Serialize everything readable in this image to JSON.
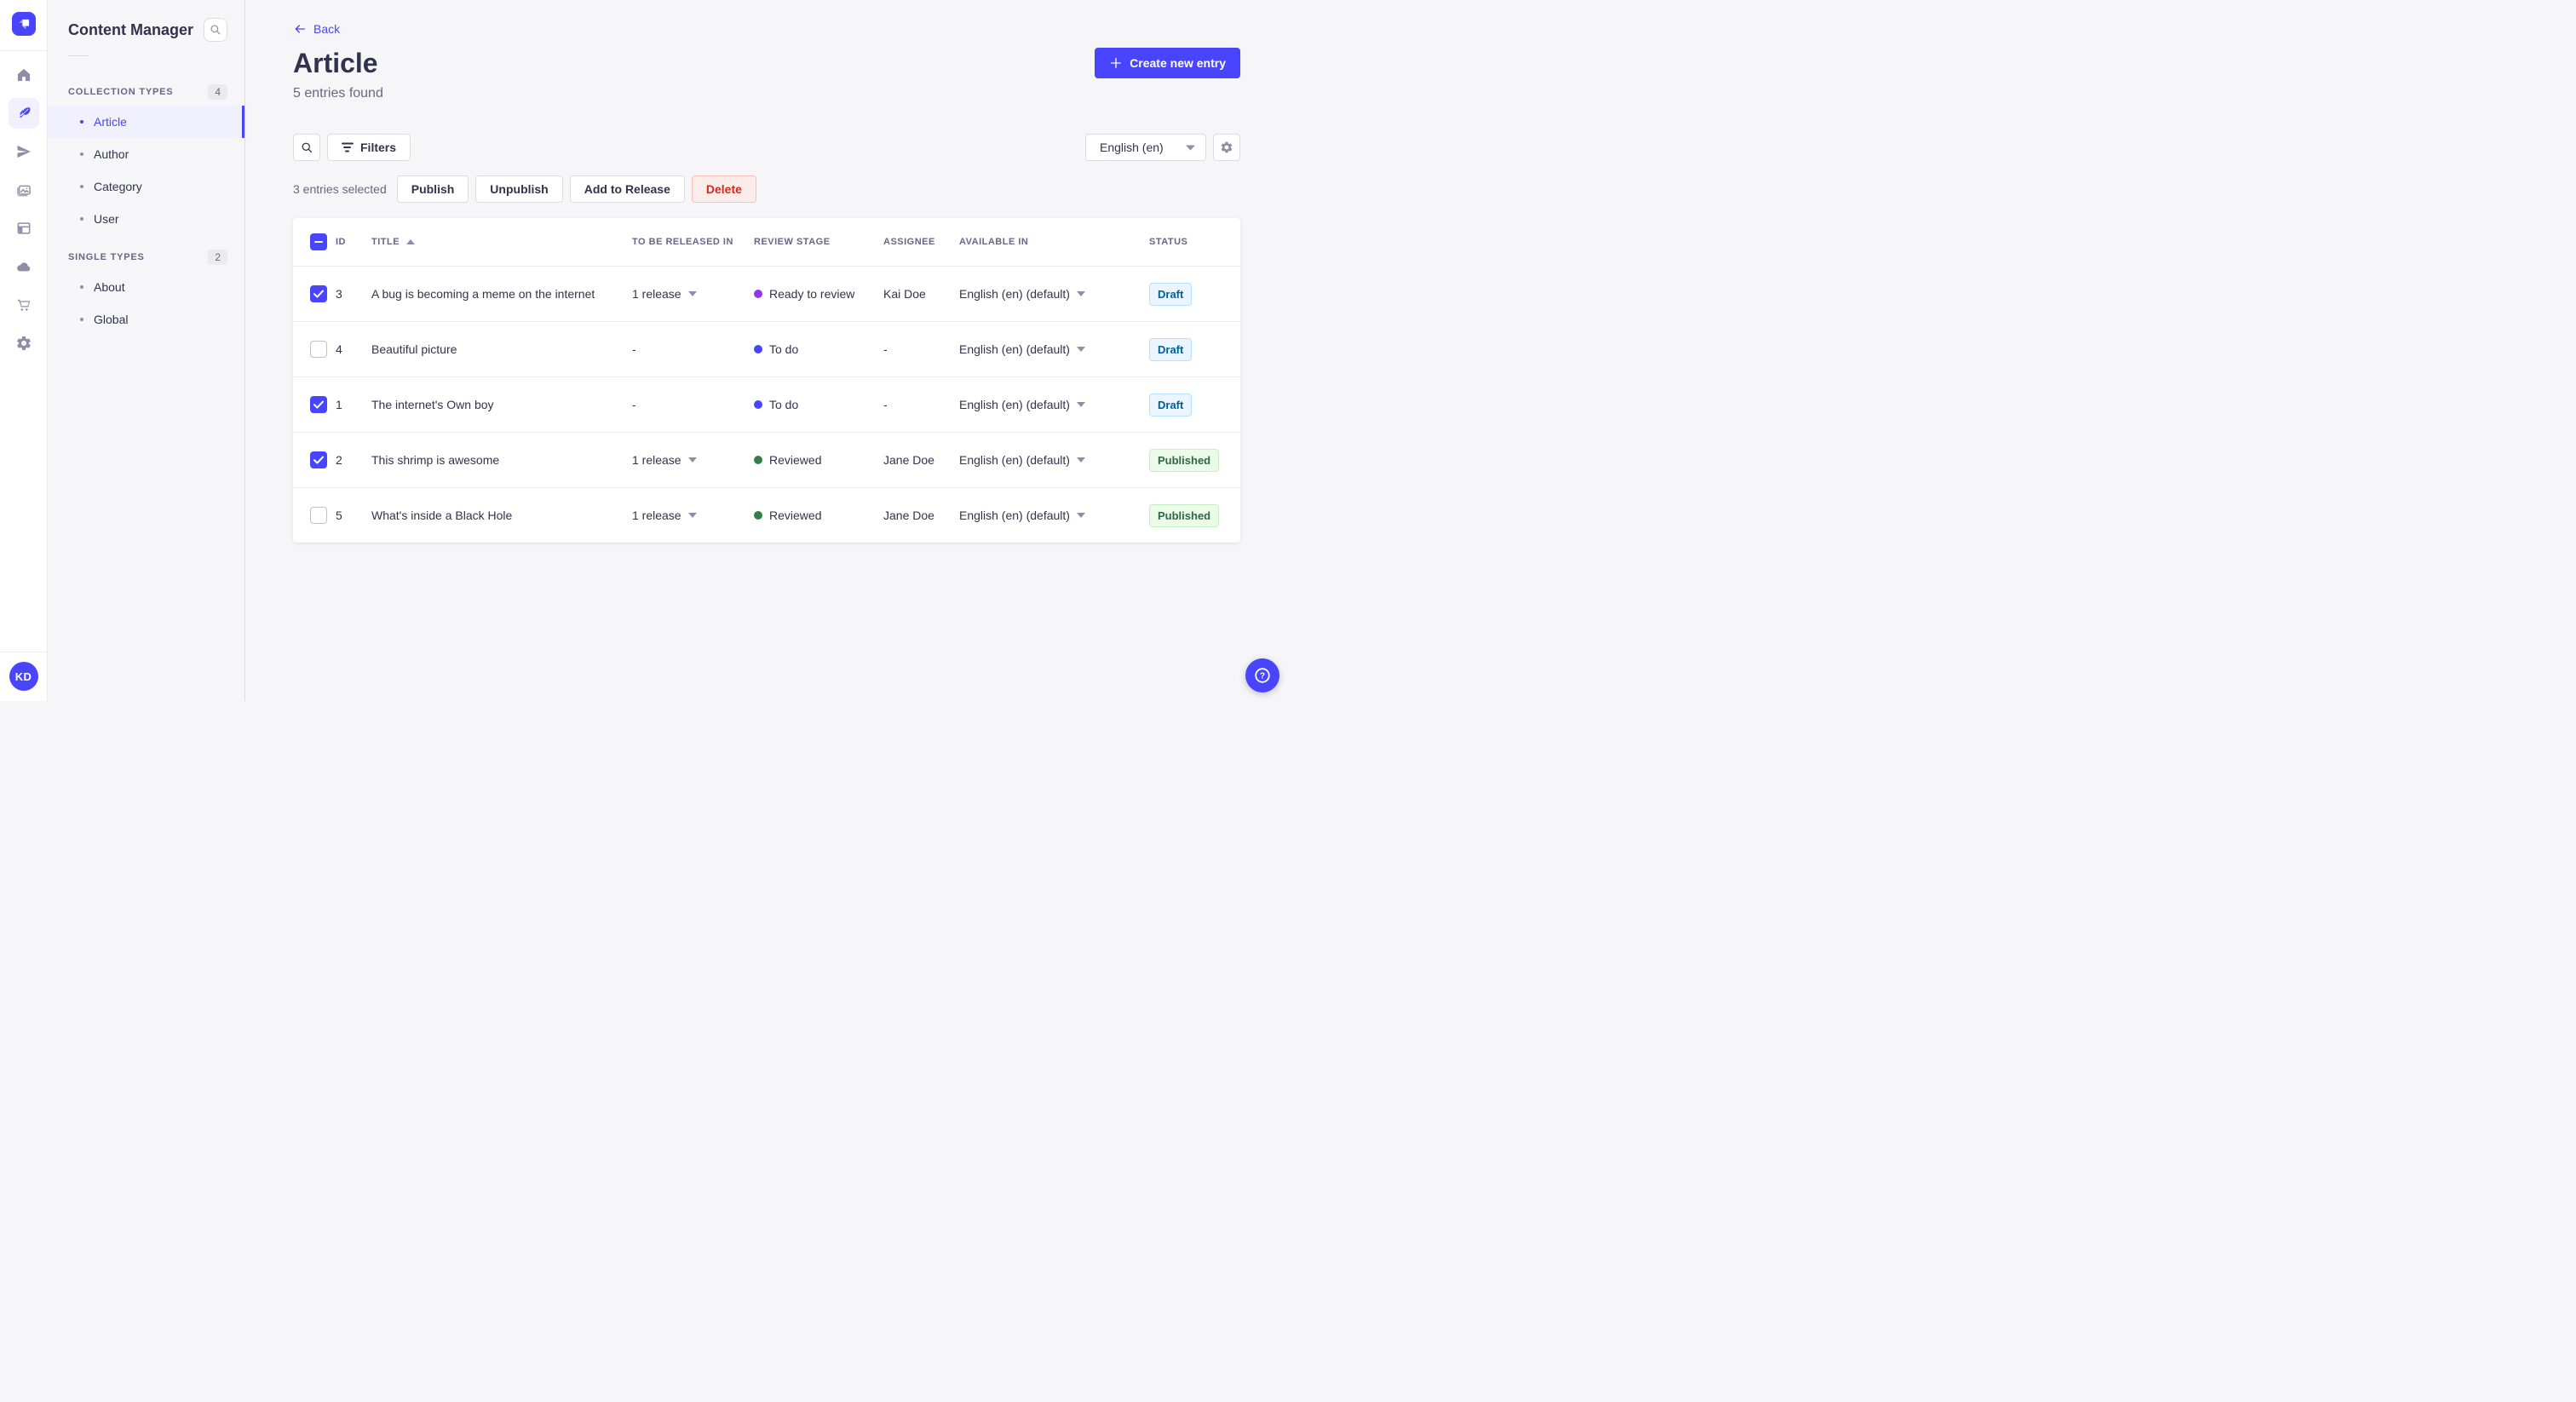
{
  "colors": {
    "primary": "#4945ff",
    "primary_bg": "#f0f0ff",
    "stage_ready_to_review": "#9736e8",
    "stage_to_do": "#4945ff",
    "stage_reviewed": "#328048",
    "draft_text": "#006096",
    "published_text": "#2f6846",
    "danger_text": "#d02b20"
  },
  "icons": {
    "strapi-logo": "purple rounded square with white folded-flag glyph",
    "home-icon": "house",
    "content-manager-icon": "feather pen (active)",
    "releases-icon": "paper plane",
    "media-library-icon": "photo stack",
    "content-type-builder-icon": "window layout",
    "deployments-icon": "cloud",
    "marketplace-icon": "shopping cart",
    "settings-icon": "gear",
    "search-icon": "magnifier",
    "filters-icon": "funnel lines",
    "back-arrow-icon": "arrow left",
    "plus-icon": "plus",
    "sort-asc-icon": "triangle up",
    "caret-down-icon": "triangle down",
    "help-icon": "question mark in circle"
  },
  "user": {
    "initials": "KD"
  },
  "sidebar": {
    "title": "Content Manager",
    "sections": [
      {
        "label": "COLLECTION TYPES",
        "count": "4",
        "items": [
          {
            "label": "Article",
            "active": true
          },
          {
            "label": "Author",
            "active": false
          },
          {
            "label": "Category",
            "active": false
          },
          {
            "label": "User",
            "active": false
          }
        ]
      },
      {
        "label": "SINGLE TYPES",
        "count": "2",
        "items": [
          {
            "label": "About",
            "active": false
          },
          {
            "label": "Global",
            "active": false
          }
        ]
      }
    ]
  },
  "header": {
    "back_label": "Back",
    "title": "Article",
    "subtitle": "5 entries found",
    "create_button": "Create new entry"
  },
  "toolbar": {
    "filters_label": "Filters",
    "locale_selected": "English (en)"
  },
  "selection": {
    "text": "3 entries selected",
    "publish": "Publish",
    "unpublish": "Unpublish",
    "add_to_release": "Add to Release",
    "delete": "Delete"
  },
  "table": {
    "select_all_state": "mixed",
    "headers": {
      "id": "ID",
      "title": "TITLE",
      "release": "TO BE RELEASED IN",
      "stage": "REVIEW STAGE",
      "assignee": "ASSIGNEE",
      "available": "AVAILABLE IN",
      "status": "STATUS"
    },
    "rows": [
      {
        "checked": true,
        "id": "3",
        "title": "A bug is becoming a meme on the internet",
        "release": "1 release",
        "release_menu": true,
        "stage": "Ready to review",
        "stage_color": "#9736e8",
        "assignee": "Kai Doe",
        "locale": "English (en) (default)",
        "status": "Draft"
      },
      {
        "checked": false,
        "id": "4",
        "title": "Beautiful picture",
        "release": "-",
        "release_menu": false,
        "stage": "To do",
        "stage_color": "#4945ff",
        "assignee": "-",
        "locale": "English (en) (default)",
        "status": "Draft"
      },
      {
        "checked": true,
        "id": "1",
        "title": "The internet's Own boy",
        "release": "-",
        "release_menu": false,
        "stage": "To do",
        "stage_color": "#4945ff",
        "assignee": "-",
        "locale": "English (en) (default)",
        "status": "Draft"
      },
      {
        "checked": true,
        "id": "2",
        "title": "This shrimp is awesome",
        "release": "1 release",
        "release_menu": true,
        "stage": "Reviewed",
        "stage_color": "#328048",
        "assignee": "Jane Doe",
        "locale": "English (en) (default)",
        "status": "Published"
      },
      {
        "checked": false,
        "id": "5",
        "title": "What's inside a Black Hole",
        "release": "1 release",
        "release_menu": true,
        "stage": "Reviewed",
        "stage_color": "#328048",
        "assignee": "Jane Doe",
        "locale": "English (en) (default)",
        "status": "Published"
      }
    ]
  }
}
